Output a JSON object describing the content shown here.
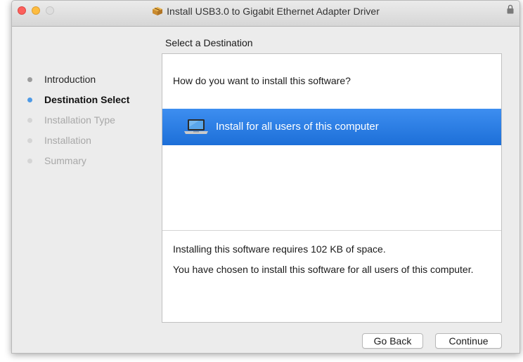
{
  "window": {
    "title": "Install USB3.0 to Gigabit Ethernet Adapter Driver",
    "title_icon": "installer-package-icon",
    "lock_icon": "lock-icon"
  },
  "sidebar": {
    "steps": [
      {
        "label": "Introduction",
        "state": "done"
      },
      {
        "label": "Destination Select",
        "state": "current"
      },
      {
        "label": "Installation Type",
        "state": "future"
      },
      {
        "label": "Installation",
        "state": "future"
      },
      {
        "label": "Summary",
        "state": "future"
      }
    ]
  },
  "main": {
    "section_title": "Select a Destination",
    "question": "How do you want to install this software?",
    "option": {
      "label": "Install for all users of this computer",
      "icon": "laptop-icon",
      "selected": true
    },
    "space_info": "Installing this software requires 102 KB of space.",
    "choice_info": "You have chosen to install this software for all users of this computer."
  },
  "buttons": {
    "go_back": "Go Back",
    "continue": "Continue"
  },
  "colors": {
    "selection": "#2a7de1",
    "current_step_dot": "#4e9ae6",
    "close": "#fc605c",
    "minimize": "#fdbc40"
  }
}
